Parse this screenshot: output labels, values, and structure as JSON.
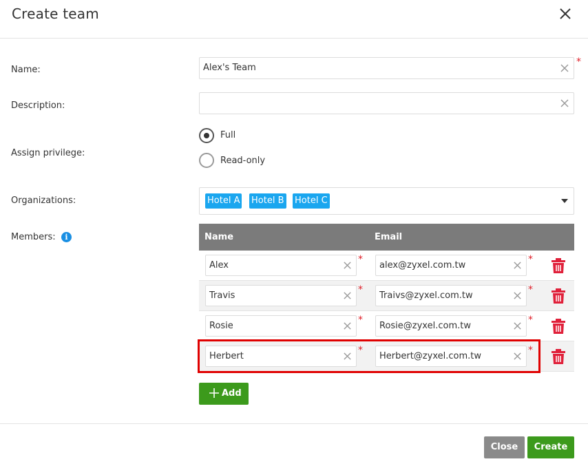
{
  "dialog": {
    "title": "Create team"
  },
  "form": {
    "name_label": "Name:",
    "name_value": "Alex's Team",
    "description_label": "Description:",
    "description_value": "",
    "privilege_label": "Assign privilege:",
    "privilege_options": [
      {
        "label": "Full",
        "checked": true
      },
      {
        "label": "Read-only",
        "checked": false
      }
    ],
    "organizations_label": "Organizations:",
    "organizations": [
      "Hotel A",
      "Hotel B",
      "Hotel C"
    ],
    "members_label": "Members:",
    "required_mark": "*"
  },
  "members_table": {
    "columns": [
      "Name",
      "Email"
    ],
    "rows": [
      {
        "name": "Alex",
        "email": "alex@zyxel.com.tw"
      },
      {
        "name": "Travis",
        "email": "Traivs@zyxel.com.tw"
      },
      {
        "name": "Rosie",
        "email": "Rosie@zyxel.com.tw"
      },
      {
        "name": "Herbert",
        "email": "Herbert@zyxel.com.tw"
      }
    ],
    "add_label": "Add"
  },
  "footer": {
    "close_label": "Close",
    "create_label": "Create"
  },
  "colors": {
    "accent_green": "#3c9a1c",
    "tag_blue": "#1aa6ef",
    "delete_red": "#e0203a",
    "highlight_red": "#e00000"
  },
  "icons": {
    "close": "close-icon",
    "clear": "clear-icon",
    "info": "info-icon",
    "delete": "trash-icon",
    "add": "plus-icon",
    "dropdown": "chevron-down-icon"
  }
}
